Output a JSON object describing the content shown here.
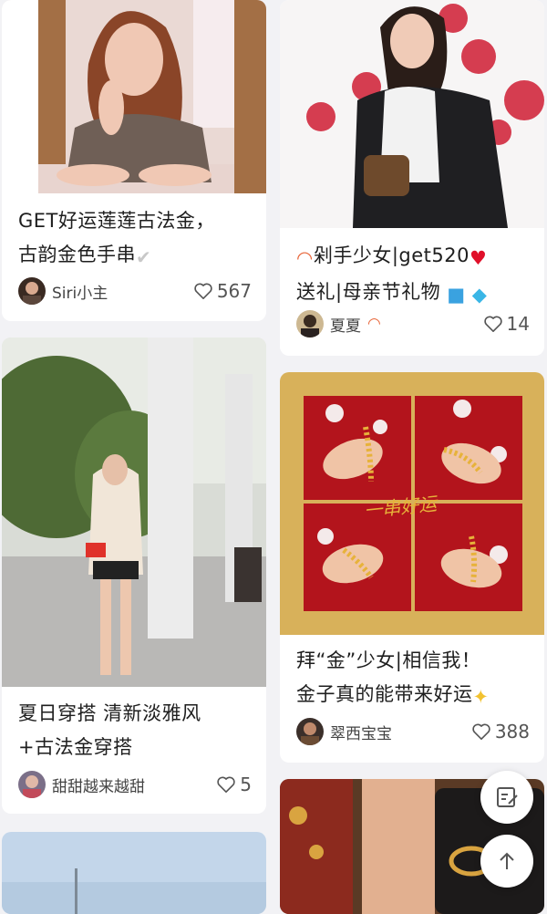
{
  "cards": [
    {
      "title_line1": "GET好运莲莲古法金，",
      "title_line2": "古韵金色手串",
      "author": "Siri小主",
      "likes": "567"
    },
    {
      "title_line1": "剁手少女|get520",
      "title_line2": "送礼|母亲节礼物",
      "author": "夏夏",
      "likes": "14"
    },
    {
      "title_line1": "夏日穿搭 清新淡雅风",
      "title_line2": "+古法金穿搭",
      "author": "甜甜越来越甜",
      "likes": "5"
    },
    {
      "title_line1": "拜“金”少女|相信我！",
      "title_line2": "金子真的能带来好运",
      "author": "翠西宝宝",
      "likes": "388"
    }
  ],
  "image_overlay_text": "一串好运",
  "icons": [
    "heart-outline-icon",
    "edit-note-icon",
    "arrow-up-icon",
    "rainbow-emoji",
    "red-heart-emoji",
    "gift-emoji",
    "diamond-emoji",
    "sparkles-emoji",
    "check-mark-emoji"
  ],
  "colors": {
    "background": "#f2f2f5",
    "card": "#ffffff",
    "title": "#1e1e1e",
    "muted": "#555555",
    "gold": "#d8b15a",
    "red": "#b3141c"
  }
}
